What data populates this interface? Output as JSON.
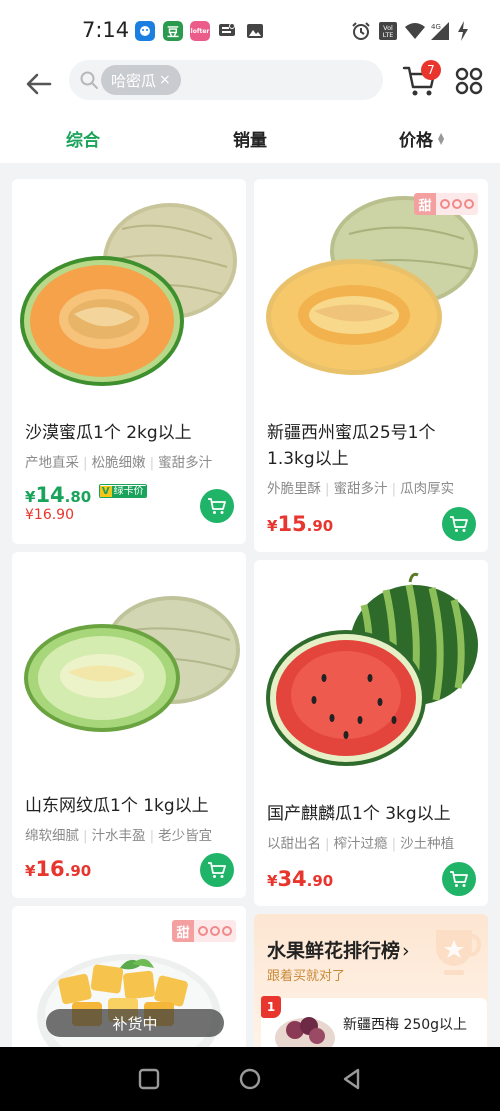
{
  "status_bar": {
    "time": "7:14",
    "apps": [
      "xiaohongshu-app",
      "douban-app",
      "lofter-app",
      "message-app",
      "gallery-app"
    ],
    "app_glyphs": {
      "douban": "豆",
      "lofter": "lofter"
    },
    "indicators": [
      "alarm-icon",
      "volte-icon",
      "wifi-icon",
      "4g-signal-icon",
      "charging-icon"
    ],
    "volte_label": "VoLTE",
    "network_label": "4G"
  },
  "header": {
    "search_chip": "哈密瓜",
    "chip_close": "×",
    "cart_count": "7"
  },
  "tabs": [
    {
      "label": "综合",
      "active": true
    },
    {
      "label": "销量",
      "active": false
    },
    {
      "label": "价格",
      "active": false,
      "sortable": true
    }
  ],
  "products": [
    {
      "title": "沙漠蜜瓜1个 2kg以上",
      "tags": [
        "产地直采",
        "松脆细嫩",
        "蜜甜多汁"
      ],
      "price_symbol": "¥",
      "price_int": "14",
      "price_dec": ".80",
      "member_badge_v": "V",
      "member_badge_text": "绿卡价",
      "original_price": "¥16.90"
    },
    {
      "title": "新疆西州蜜瓜25号1个 1.3kg以上",
      "tags": [
        "外脆里酥",
        "蜜甜多汁",
        "瓜肉厚实"
      ],
      "price_symbol": "¥",
      "price_int": "15",
      "price_dec": ".90",
      "badge": "甜"
    },
    {
      "title": "山东网纹瓜1个 1kg以上",
      "tags": [
        "绵软细腻",
        "汁水丰盈",
        "老少皆宜"
      ],
      "price_symbol": "¥",
      "price_int": "16",
      "price_dec": ".90"
    },
    {
      "title": "国产麒麟瓜1个 3kg以上",
      "tags": [
        "以甜出名",
        "榨汁过瘾",
        "沙土种植"
      ],
      "price_symbol": "¥",
      "price_int": "34",
      "price_dec": ".90"
    },
    {
      "badge": "甜",
      "status": "补货中"
    }
  ],
  "ranking": {
    "title": "水果鲜花排行榜",
    "arrow": "›",
    "subtitle": "跟着买就对了",
    "top_rank": "1",
    "top_item": "新疆西梅 250g以上"
  },
  "colors": {
    "accent_green": "#1aa35a",
    "cart_button_green": "#1fb468",
    "price_red": "#e8352d",
    "background": "#f2f3f5"
  }
}
